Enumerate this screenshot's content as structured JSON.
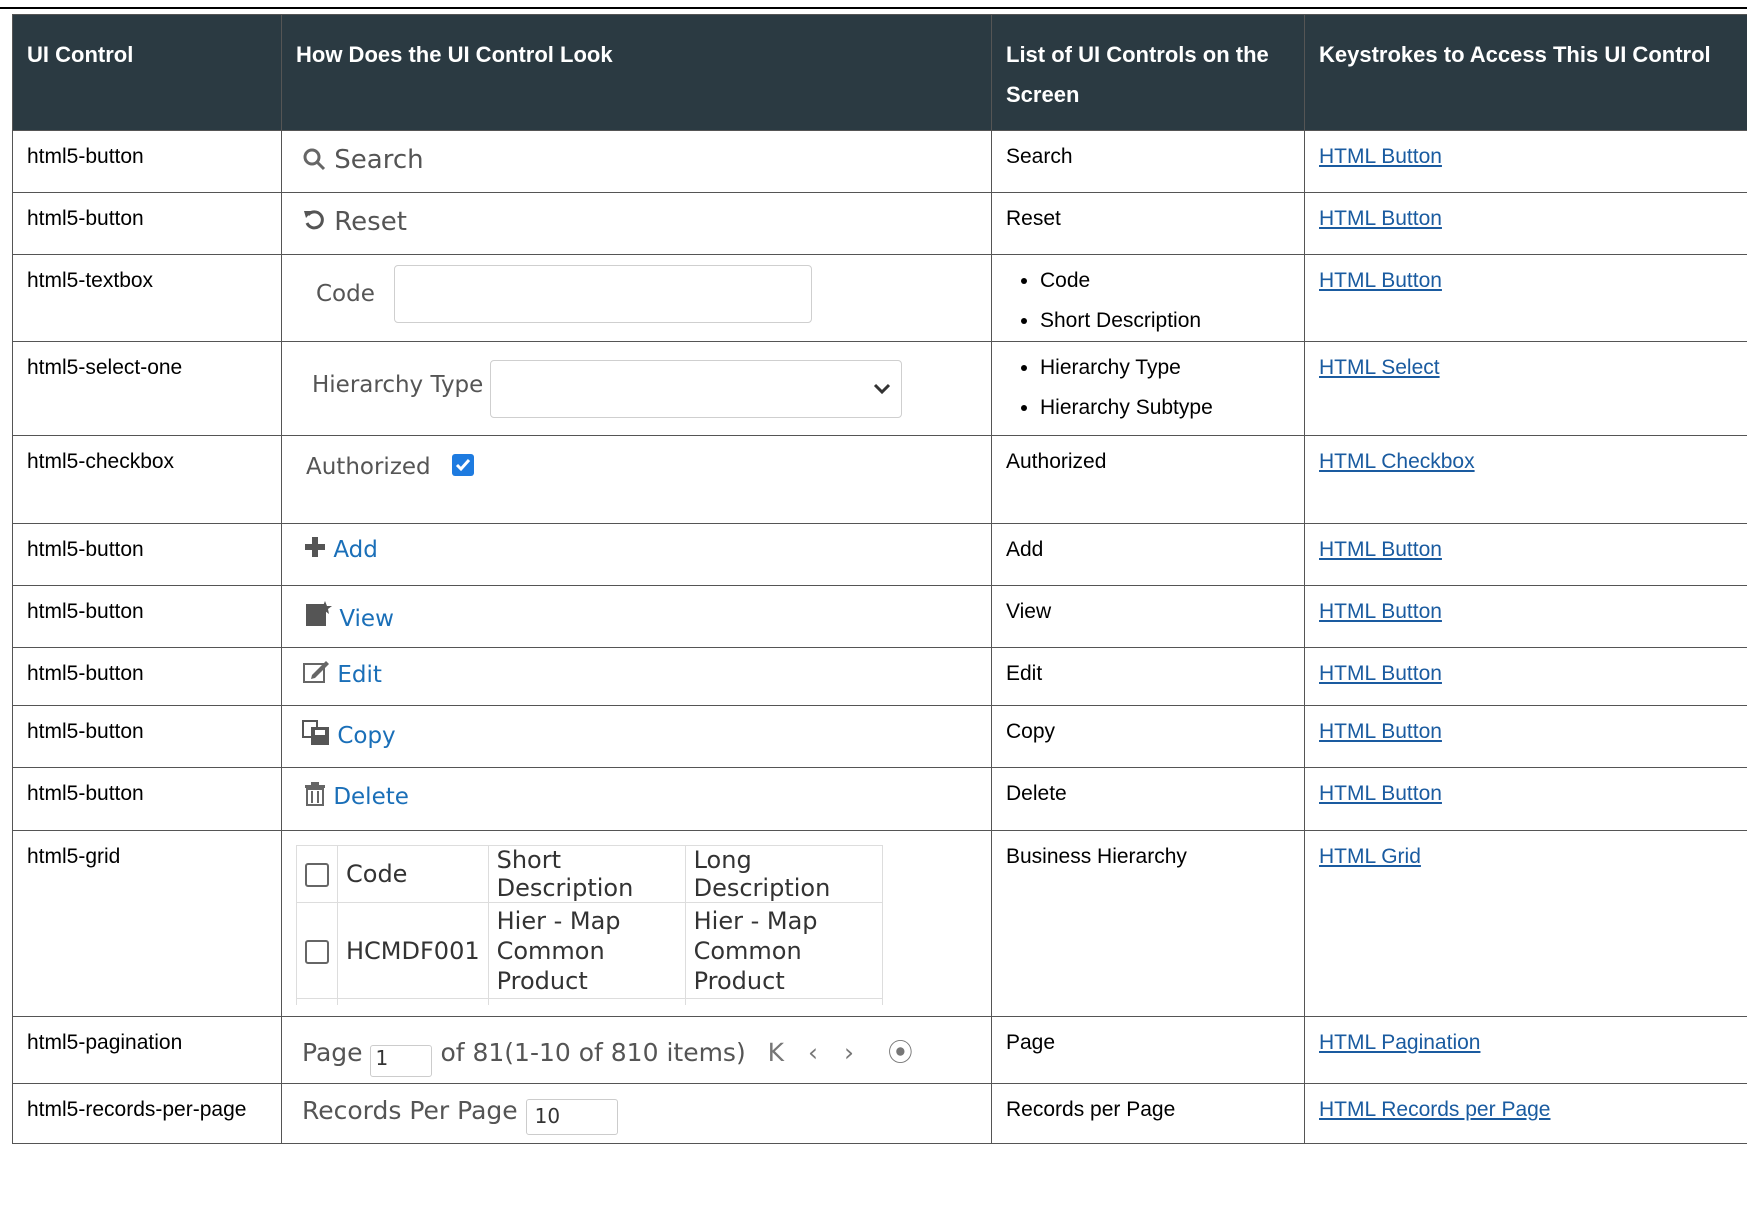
{
  "headers": [
    "UI Control",
    "How Does the UI Control Look",
    "List of UI Controls on the Screen",
    "Keystrokes to Access This UI Control"
  ],
  "rows": [
    {
      "control": "html5-button",
      "screen": [
        "Search"
      ],
      "link": "HTML Button"
    },
    {
      "control": "html5-button",
      "screen": [
        "Reset"
      ],
      "link": "HTML Button"
    },
    {
      "control": "html5-textbox",
      "screen": [
        "Code",
        "Short Description"
      ],
      "link": "HTML Button"
    },
    {
      "control": "html5-select-one",
      "screen": [
        "Hierarchy Type",
        "Hierarchy Subtype"
      ],
      "link": "HTML Select"
    },
    {
      "control": "html5-checkbox",
      "screen": [
        "Authorized"
      ],
      "link": "HTML Checkbox"
    },
    {
      "control": "html5-button",
      "screen": [
        "Add"
      ],
      "link": "HTML Button"
    },
    {
      "control": "html5-button",
      "screen": [
        "View"
      ],
      "link": "HTML Button"
    },
    {
      "control": "html5-button",
      "screen": [
        "Edit"
      ],
      "link": "HTML Button"
    },
    {
      "control": "html5-button",
      "screen": [
        "Copy"
      ],
      "link": "HTML Button"
    },
    {
      "control": "html5-button",
      "screen": [
        "Delete"
      ],
      "link": "HTML Button"
    },
    {
      "control": "html5-grid",
      "screen": [
        "Business Hierarchy"
      ],
      "link": "HTML Grid"
    },
    {
      "control": "html5-pagination",
      "screen": [
        "Page"
      ],
      "link": "HTML Pagination"
    },
    {
      "control": "html5-records-per-page",
      "screen": [
        "Records per Page"
      ],
      "link": "HTML Records per Page"
    }
  ],
  "looks": {
    "search": "Search",
    "reset": "Reset",
    "code_label": "Code",
    "hierarchy_label": "Hierarchy Type",
    "authorized_label": "Authorized",
    "authorized_checked": true,
    "add": "Add",
    "view": "View",
    "edit": "Edit",
    "copy": "Copy",
    "delete": "Delete",
    "grid": {
      "headers": [
        "Code",
        "Short Description",
        "Long Description"
      ],
      "row": {
        "code": "HCMDF001",
        "short": [
          "Hier - Map",
          "Common",
          "Product"
        ],
        "long": [
          "Hier - Map",
          "Common",
          "Product"
        ]
      }
    },
    "pagination": {
      "page_label": "Page",
      "page_value": "1",
      "of_text": "of 81",
      "items_text": "(1-10 of 810 items)"
    },
    "records": {
      "label": "Records Per Page",
      "value": "10"
    }
  },
  "colors": {
    "header_bg": "#2b3a42",
    "link": "#1a5ba0",
    "accent_blue": "#1a6fb8",
    "checkbox": "#1e7be0"
  }
}
